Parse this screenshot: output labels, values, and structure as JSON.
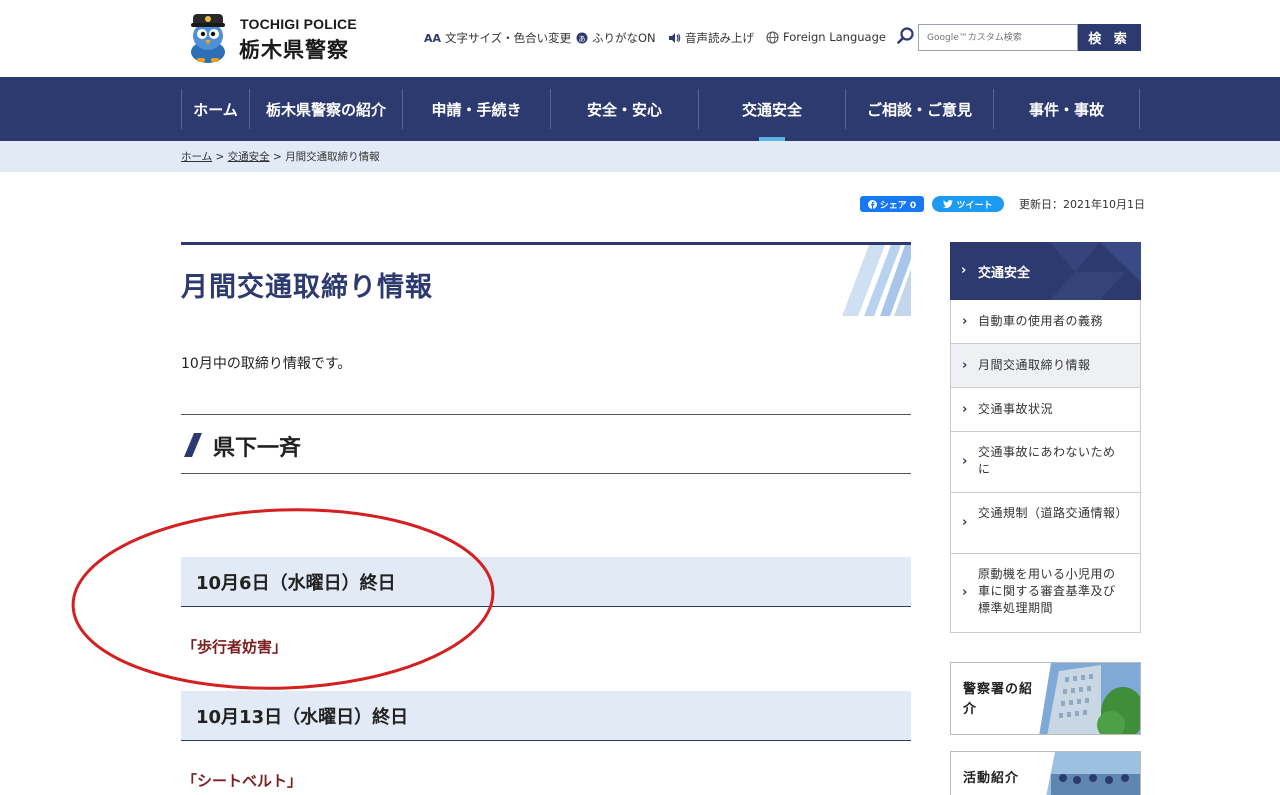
{
  "header": {
    "logo_en": "TOCHIGI POLICE",
    "logo_ja": "栃木県警察",
    "utilities": [
      {
        "icon": "text-size-icon",
        "label": "文字サイズ・色合い変更"
      },
      {
        "icon": "furigana-icon",
        "label": "ふりがなON"
      },
      {
        "icon": "speaker-icon",
        "label": "音声読み上げ"
      },
      {
        "icon": "globe-icon",
        "label": "Foreign Language"
      }
    ],
    "search_placeholder": "Google™カスタム検索",
    "search_button": "検 索"
  },
  "nav": {
    "items": [
      {
        "label": "ホーム",
        "active": false
      },
      {
        "label": "栃木県警察の紹介",
        "active": false
      },
      {
        "label": "申請・手続き",
        "active": false
      },
      {
        "label": "安全・安心",
        "active": false
      },
      {
        "label": "交通安全",
        "active": true
      },
      {
        "label": "ご相談・ご意見",
        "active": false
      },
      {
        "label": "事件・事故",
        "active": false
      }
    ]
  },
  "breadcrumb": {
    "home": "ホーム",
    "sep": ">",
    "section": "交通安全",
    "current": "月間交通取締り情報"
  },
  "share": {
    "facebook_label": "シェア 0",
    "twitter_label": "ツイート",
    "updated": "更新日：2021年10月1日"
  },
  "main": {
    "title": "月間交通取締り情報",
    "intro": "10月中の取締り情報です。",
    "section_heading": "県下一斉",
    "entries": [
      {
        "date": "10月6日（水曜日）終日",
        "item": "「歩行者妨害」"
      },
      {
        "date": "10月13日（水曜日）終日",
        "item": "「シートベルト」"
      }
    ]
  },
  "sidebar": {
    "heading": "交通安全",
    "items": [
      {
        "label": "自動車の使用者の義務",
        "current": false
      },
      {
        "label": "月間交通取締り情報",
        "current": true
      },
      {
        "label": "交通事故状況",
        "current": false
      },
      {
        "label": "交通事故にあわないために",
        "current": false
      },
      {
        "label": "交通規制（道路交通情報）",
        "current": false
      },
      {
        "label": "原動機を用いる小児用の車に関する審査基準及び標準処理期間",
        "current": false
      }
    ],
    "banners": [
      {
        "label": "警察署の紹介"
      },
      {
        "label": "活動紹介"
      }
    ]
  },
  "colors": {
    "brand_navy": "#2c3a70",
    "accent_blue": "#5ab4e6",
    "light_blue_bg": "#e2eaf5",
    "annotation_red": "#d42020",
    "item_text": "#7a1f1f"
  }
}
